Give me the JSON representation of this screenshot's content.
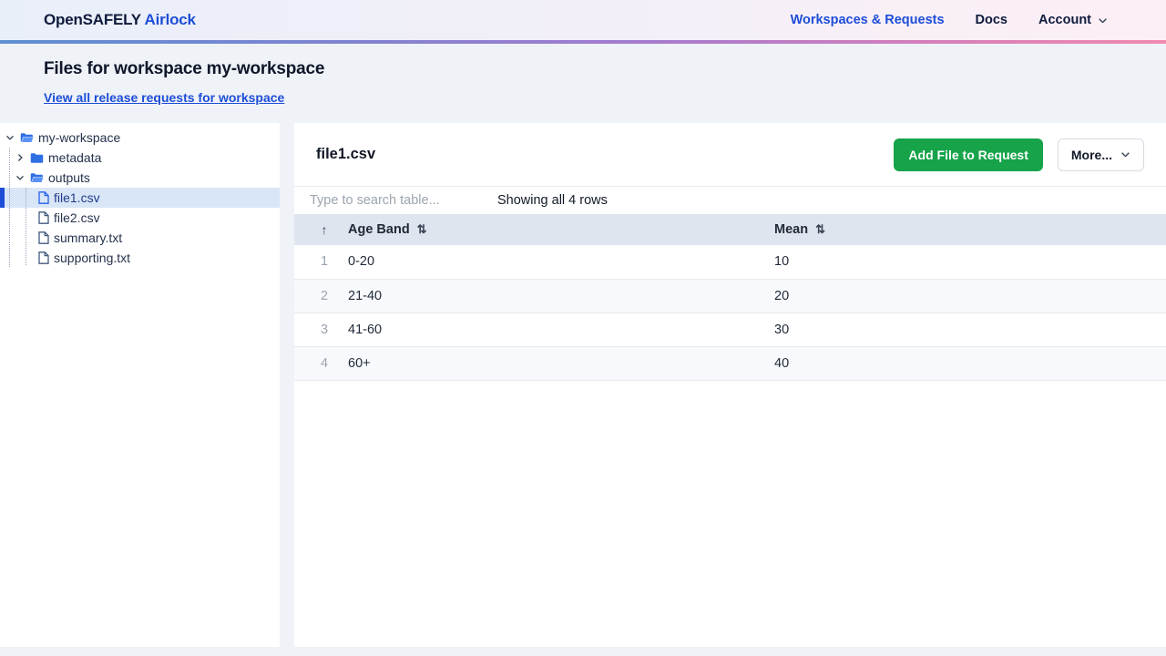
{
  "nav": {
    "brand_primary": "OpenSAFELY",
    "brand_secondary": " Airlock",
    "links": [
      {
        "label": "Workspaces & Requests"
      },
      {
        "label": "Docs"
      }
    ],
    "account_label": "Account"
  },
  "page_header": {
    "title": "Files for workspace my-workspace",
    "link_label": "View all release requests for workspace"
  },
  "sidebar": {
    "tree": [
      {
        "label": "my-workspace",
        "type": "folder-open",
        "expanded": true
      },
      {
        "label": "metadata",
        "type": "folder-closed",
        "expanded": false
      },
      {
        "label": "outputs",
        "type": "folder-open",
        "expanded": true
      },
      {
        "label": "file1.csv",
        "type": "file",
        "selected": true
      },
      {
        "label": "file2.csv",
        "type": "file",
        "selected": false
      },
      {
        "label": "summary.txt",
        "type": "file",
        "selected": false
      },
      {
        "label": "supporting.txt",
        "type": "file",
        "selected": false
      }
    ]
  },
  "main": {
    "file_title": "file1.csv",
    "add_file_button": "Add File to Request",
    "more_button": "More...",
    "search_placeholder": "Type to search table...",
    "rows_status": "Showing all 4 rows",
    "table": {
      "sorted_icon": "↑",
      "sort_icon": "⇅",
      "columns": [
        "Age Band",
        "Mean"
      ],
      "rows": [
        {
          "num": "1",
          "age_band": "0-20",
          "mean": "10"
        },
        {
          "num": "2",
          "age_band": "21-40",
          "mean": "20"
        },
        {
          "num": "3",
          "age_band": "41-60",
          "mean": "30"
        },
        {
          "num": "4",
          "age_band": "60+",
          "mean": "40"
        }
      ]
    }
  },
  "colors": {
    "link_blue": "#1d4ed8",
    "brand_dark": "#0f1b3d",
    "accent_green": "#16a34a",
    "selected_row_bg": "#d9e6f8",
    "selected_bar": "#1d4ed8",
    "table_header_bg": "#dfe5ef",
    "stripe_row_bg": "#f7f9fc",
    "gradient_left": "#5e8fcf",
    "gradient_mid": "#a47bce",
    "gradient_right": "#f08bb0"
  }
}
